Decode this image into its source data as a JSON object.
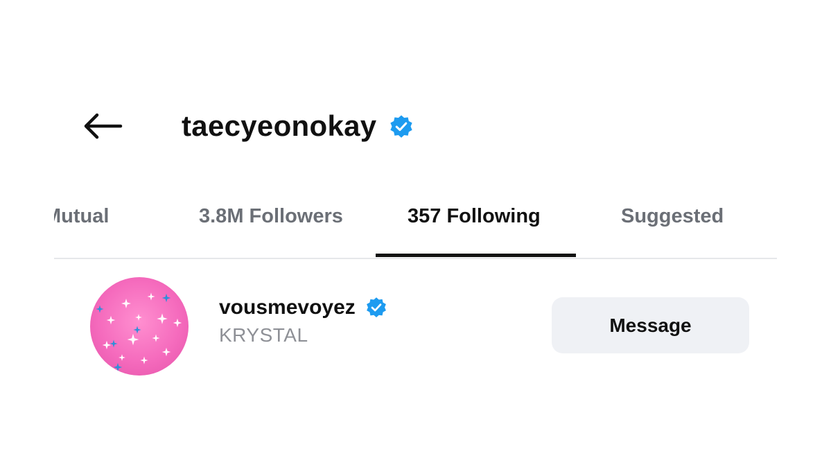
{
  "header": {
    "back_icon": "arrow-left-icon",
    "title": "taecyeonokay",
    "verified_icon": "verified-badge-icon"
  },
  "tabs": [
    {
      "label": "Mutual",
      "active": false
    },
    {
      "label": "3.8M Followers",
      "active": false
    },
    {
      "label": "357 Following",
      "active": true
    },
    {
      "label": "Suggested",
      "active": false
    }
  ],
  "list": [
    {
      "username": "vousmevoyez",
      "fullname": "KRYSTAL",
      "verified": true,
      "action_label": "Message",
      "avatar_icon": "pink-sparkle-avatar"
    }
  ],
  "colors": {
    "verified_blue": "#1d9bf0",
    "text_primary": "#111111",
    "text_secondary": "#6b6f76",
    "button_bg": "#eff1f5",
    "avatar_pink": "#f56bbd"
  }
}
